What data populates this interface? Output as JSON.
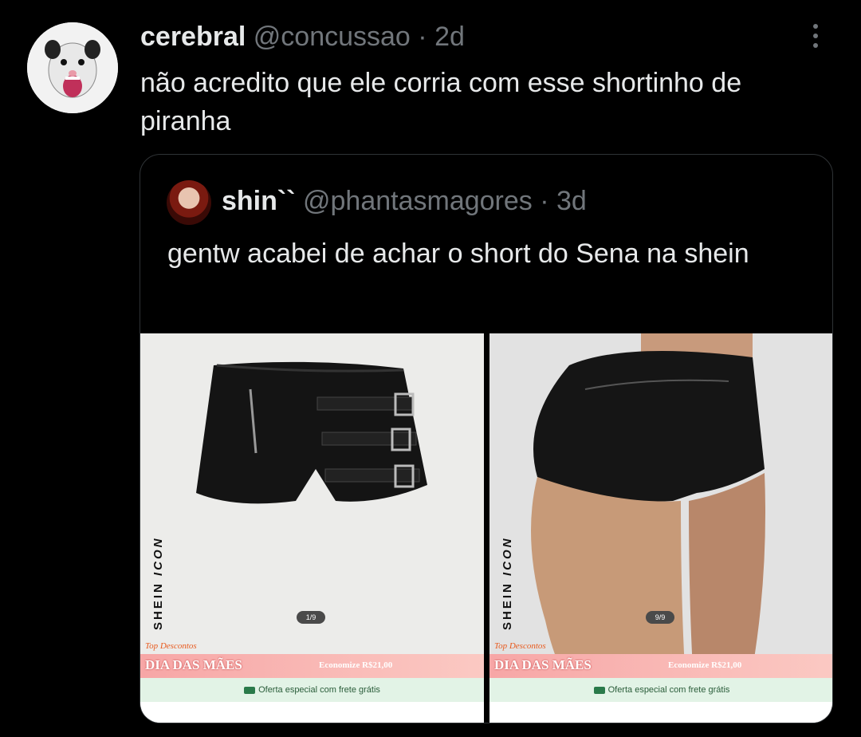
{
  "tweet": {
    "display_name": "cerebral",
    "handle": "@concussao",
    "time": "· 2d",
    "text": "não acredito que ele corria com esse shortinho de piranha"
  },
  "quote": {
    "display_name": "shin``",
    "handle": "@phantasmagores",
    "time": "· 3d",
    "text": "gentw acabei de achar o short do Sena na shein"
  },
  "images": [
    {
      "brand": "SHEIN",
      "brand_italic": "ICON",
      "counter": "1/9",
      "promo_tag": "Top Descontos",
      "promo_title": "DIA DAS MÃES",
      "promo_savings": "Economize R$21,00",
      "shipping": "Oferta especial com frete grátis"
    },
    {
      "brand": "SHEIN",
      "brand_italic": "ICON",
      "counter": "9/9",
      "promo_tag": "Top Descontos",
      "promo_title": "DIA DAS MÃES",
      "promo_savings": "Economize R$21,00",
      "shipping": "Oferta especial com frete grátis"
    }
  ],
  "colors": {
    "background": "#000000",
    "text_primary": "#e7e9ea",
    "text_muted": "#71767b",
    "border": "#2f3336",
    "promo_orange": "#e85a1e"
  }
}
